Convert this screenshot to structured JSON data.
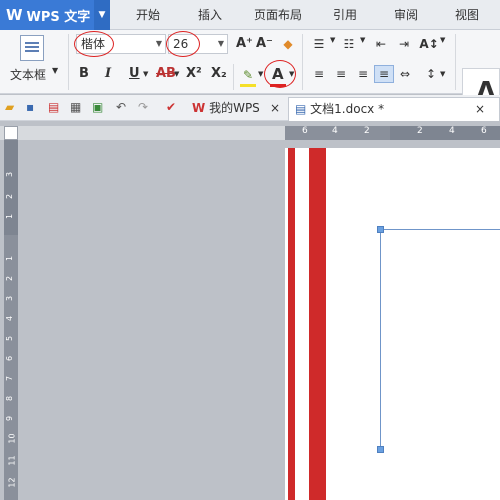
{
  "app": {
    "logo": "W",
    "name": "WPS 文字",
    "dropdown_icon": "caret-down"
  },
  "menu": {
    "tabs": [
      "开始",
      "插入",
      "页面布局",
      "引用",
      "审阅",
      "视图"
    ]
  },
  "ribbon": {
    "textbox_label": "文本框",
    "font_name": "楷体",
    "font_size": "26",
    "bold": "B",
    "italic": "I",
    "underline": "U",
    "strike": "AB",
    "superscript": "X²",
    "subscript": "X₂",
    "grow": "A⁺",
    "shrink": "A⁻",
    "font_color": "A",
    "style_preview": "A",
    "highlight_note": "font-name, font-size and font-color controls circled in red"
  },
  "toolbar": {
    "tabs": [
      {
        "label": "我的WPS",
        "close": "×"
      },
      {
        "label": "文档1.docx *",
        "close": "×"
      }
    ]
  },
  "ruler": {
    "h_numbers": [
      "6",
      "4",
      "2",
      "2",
      "4",
      "6"
    ],
    "v_numbers": [
      "3",
      "2",
      "1",
      "1",
      "2",
      "3",
      "4",
      "5",
      "6",
      "7",
      "8",
      "9",
      "10",
      "11",
      "12"
    ]
  },
  "colors": {
    "accent": "#3a7ad6",
    "stripe": "#cf2a2a",
    "circle": "#dd2222"
  }
}
